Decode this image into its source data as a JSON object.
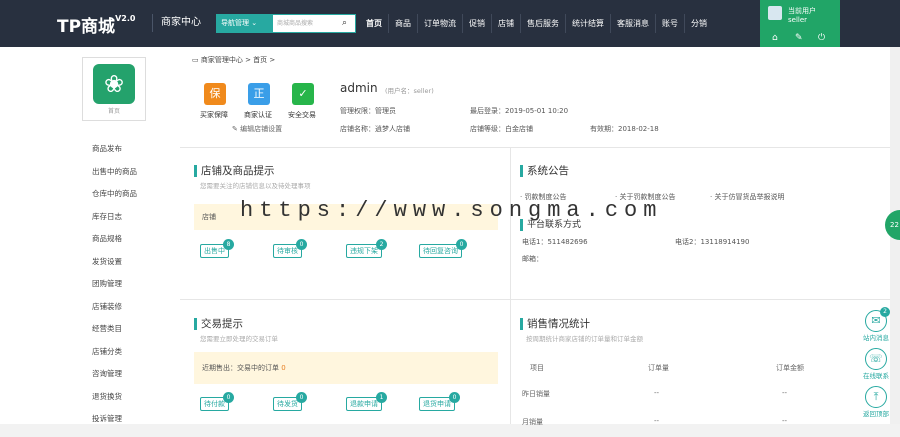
{
  "header": {
    "logo": "TP商城",
    "version": "V2.0",
    "center": "商家中心",
    "nav_select": "导航管理 ⌄",
    "search_placeholder": "商城商品搜索",
    "menu": [
      "首页",
      "商品",
      "订单物流",
      "促销",
      "店铺",
      "售后服务",
      "统计结算",
      "客服消息",
      "账号",
      "分销"
    ],
    "user_label": "当前用户",
    "username": "seller"
  },
  "sidebar": {
    "shop_label": "首页",
    "items": [
      "商品发布",
      "出售中的商品",
      "仓库中的商品",
      "库存日志",
      "商品规格",
      "发货设置",
      "团购管理",
      "店铺装修",
      "经营类目",
      "店铺分类",
      "咨询管理",
      "退货换货",
      "投诉管理"
    ]
  },
  "breadcrumb": "商家管理中心 > 首页 >",
  "badges": [
    {
      "icon": "保",
      "label": "买家保障",
      "color": "#f08a1c"
    },
    {
      "icon": "正",
      "label": "商家认证",
      "color": "#3a9ee8"
    },
    {
      "icon": "✓",
      "label": "安全交易",
      "color": "#27b54a"
    }
  ],
  "profile": {
    "name": "admin",
    "account": "(用户名：seller)",
    "permission": "管理权限：管理员",
    "last_login": "最后登录：2019-05-01 10:20",
    "shop_name": "店铺名称：逍梦人店铺",
    "shop_level": "店铺等级：白金店铺",
    "valid_until": "有效期：2018-02-18",
    "edit_link": "编辑店铺设置"
  },
  "shop_tips": {
    "title": "店铺及商品提示",
    "subtitle": "您需要关注的店铺信息以及待处理事项",
    "notice": "店铺",
    "buttons": [
      {
        "label": "出售中",
        "count": "8"
      },
      {
        "label": "待审核",
        "count": "0"
      },
      {
        "label": "违规下架",
        "count": "2"
      },
      {
        "label": "待回复咨询",
        "count": "0"
      }
    ]
  },
  "announcement": {
    "title": "系统公告",
    "items": [
      "· 罚款制度公告",
      "· 关于罚款制度公告",
      "· 关于仿冒货品举报说明"
    ],
    "contact_title": "平台联系方式",
    "phone1": "电话1：511482696",
    "phone2": "电话2：13118914190",
    "email": "邮箱："
  },
  "trade": {
    "title": "交易提示",
    "subtitle": "您需要立即处理的交易订单",
    "notice": "近期售出：交易中的订单",
    "notice_count": "0",
    "buttons": [
      {
        "label": "待付款",
        "count": "0"
      },
      {
        "label": "待发货",
        "count": "0"
      },
      {
        "label": "退款申请",
        "count": "1"
      },
      {
        "label": "退货申请",
        "count": "0"
      }
    ]
  },
  "sales": {
    "title": "销售情况统计",
    "subtitle": "按周期统计商家店铺的订单量和订单金额",
    "headers": [
      "项目",
      "订单量",
      "订单金额"
    ],
    "rows": [
      {
        "name": "昨日销量",
        "qty": "--",
        "amount": "--"
      },
      {
        "name": "月销量",
        "qty": "--",
        "amount": "--"
      }
    ]
  },
  "watermark": "https://www.songma.com",
  "right_tools": [
    {
      "label": "站内消息",
      "icon": "✉",
      "count": "2"
    },
    {
      "label": "在线联系",
      "icon": "☏",
      "count": ""
    },
    {
      "label": "返回顶部",
      "icon": "⤒",
      "count": ""
    }
  ],
  "float_label": "22"
}
